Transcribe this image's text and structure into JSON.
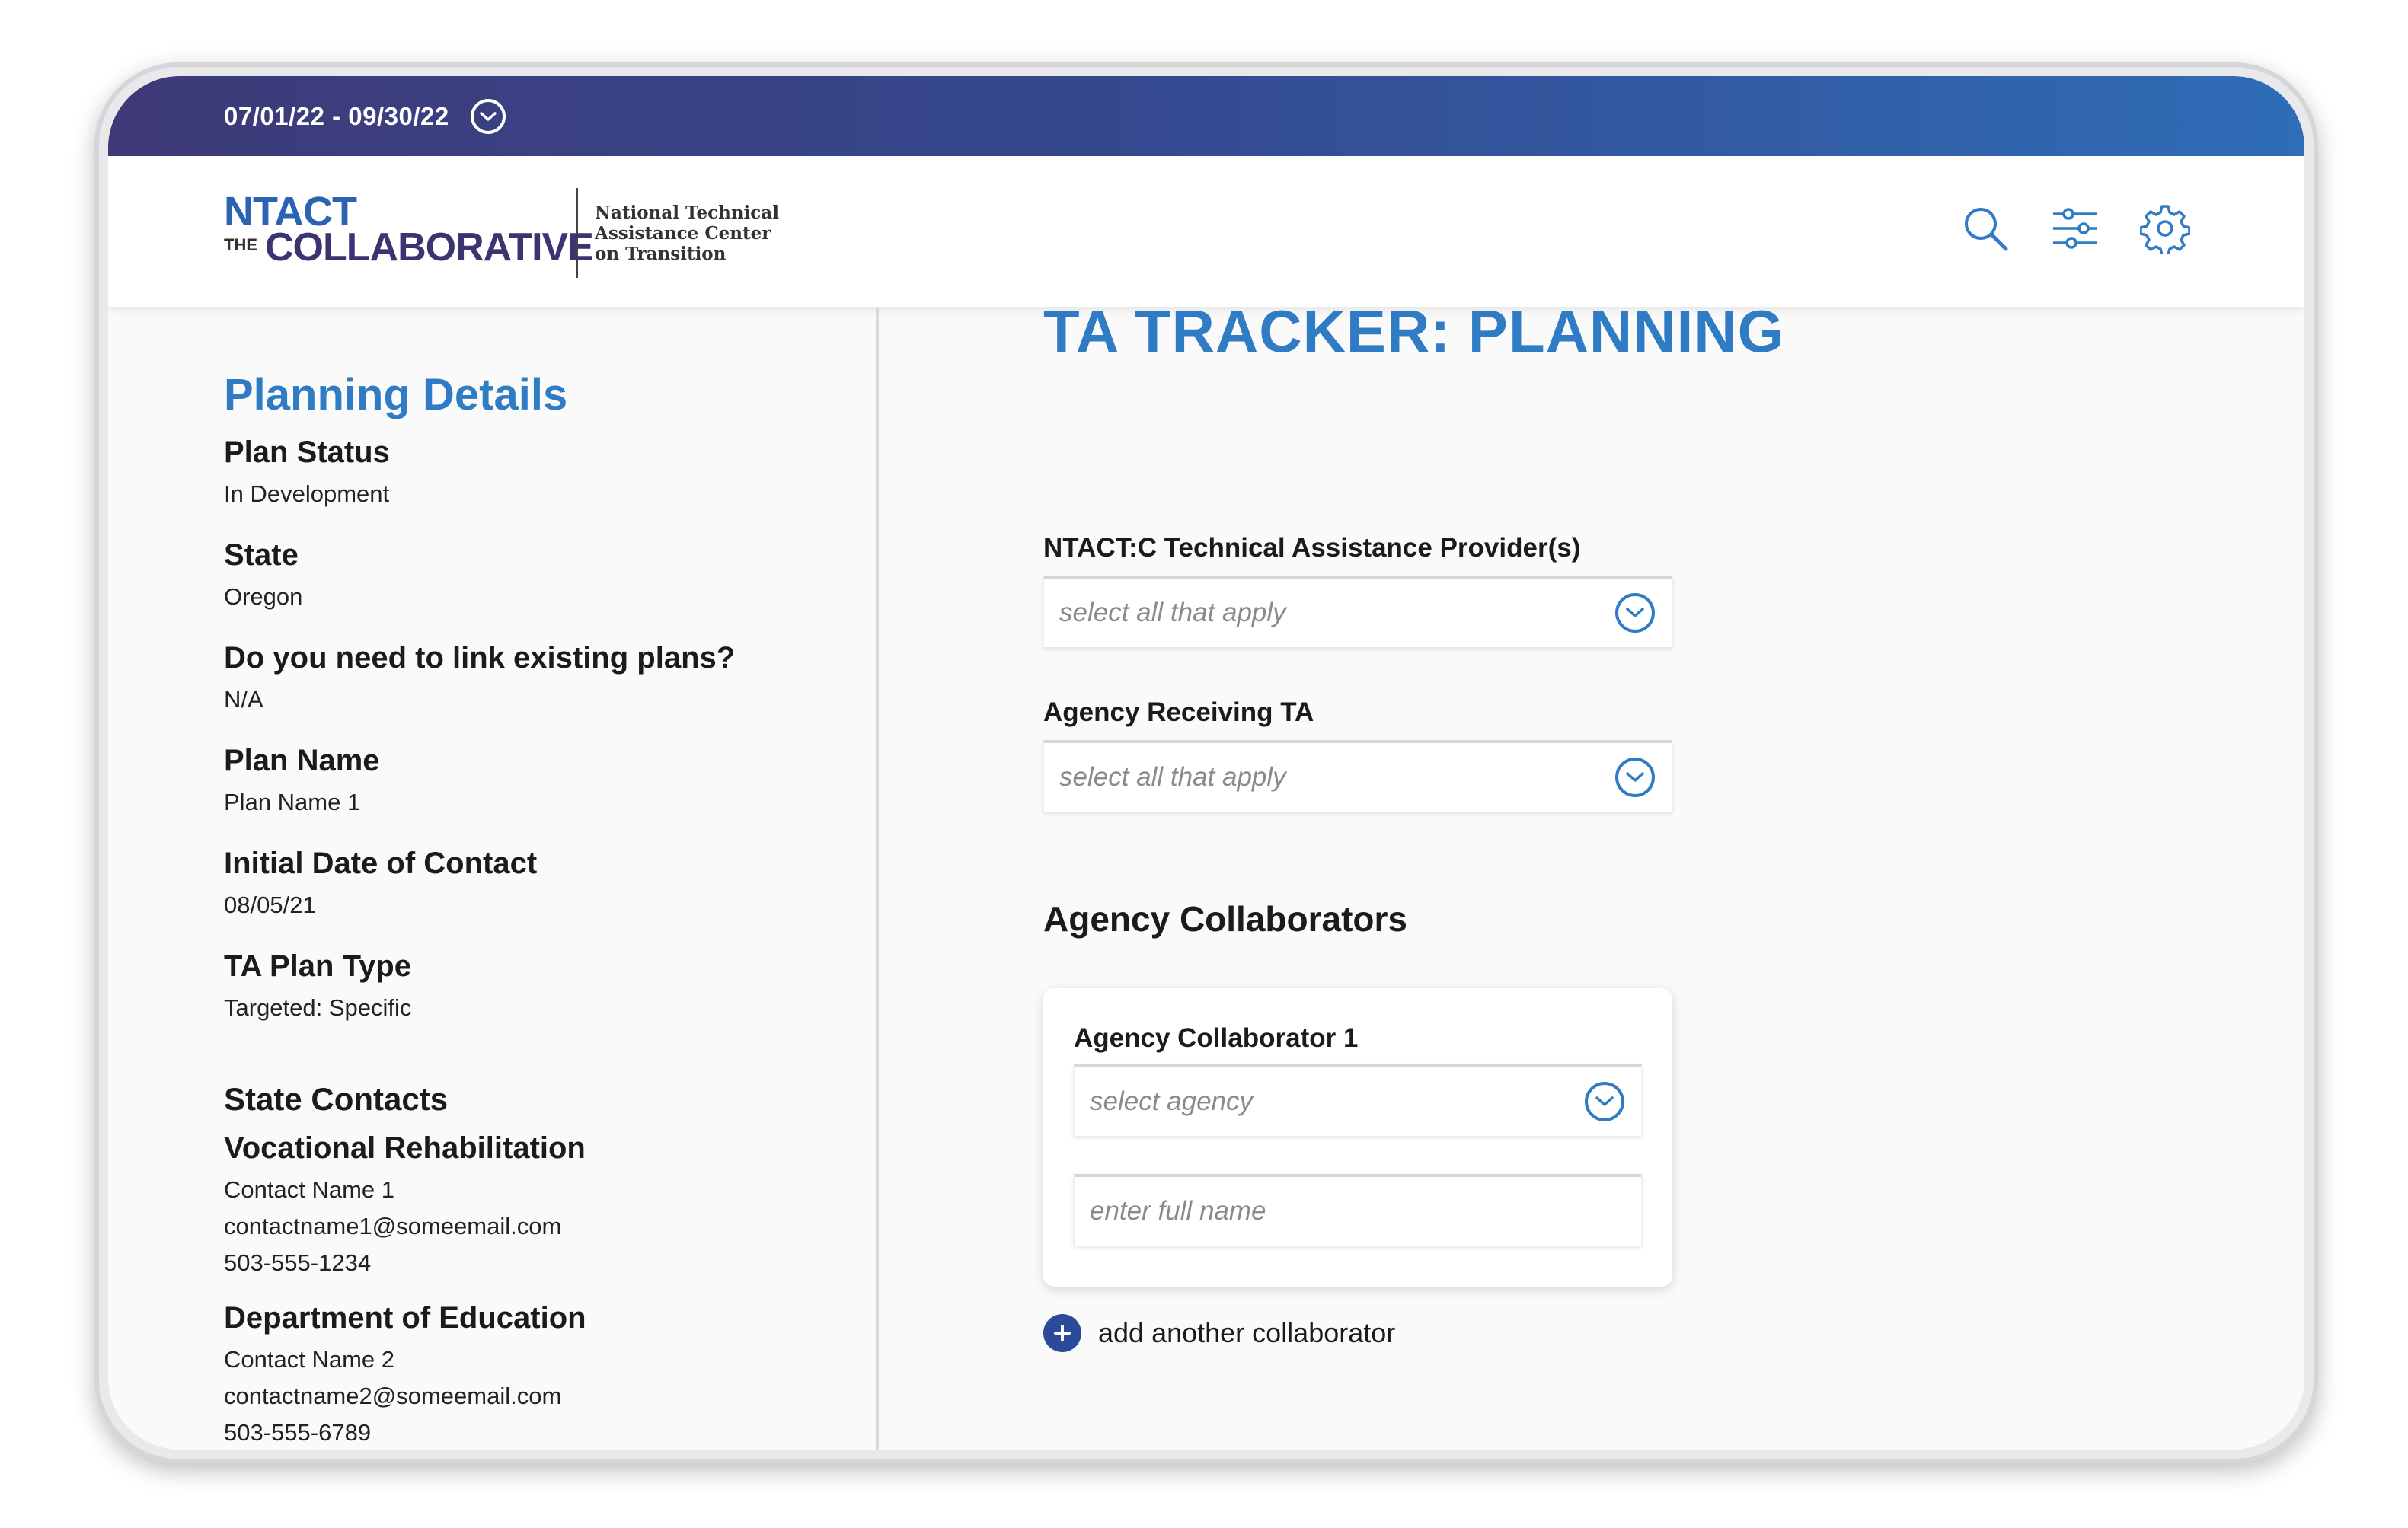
{
  "top_bar": {
    "date_range": "07/01/22 - 09/30/22"
  },
  "header": {
    "logo": {
      "ntact": "NTACT",
      "the": "THE",
      "collaborative": "COLLABORATIVE",
      "subtitle_lines": [
        "National Technical",
        "Assistance Center",
        "on Transition"
      ]
    },
    "icons": [
      "search-icon",
      "filter-sliders-icon",
      "gear-icon"
    ]
  },
  "left_panel": {
    "title": "Planning Details",
    "fields": [
      {
        "label": "Plan Status",
        "value": "In Development"
      },
      {
        "label": "State",
        "value": "Oregon"
      },
      {
        "label": "Do you need to link existing plans?",
        "value": "N/A"
      },
      {
        "label": "Plan Name",
        "value": "Plan Name 1"
      },
      {
        "label": "Initial Date of Contact",
        "value": "08/05/21"
      },
      {
        "label": "TA Plan Type",
        "value": "Targeted: Specific"
      }
    ],
    "state_contacts": {
      "title": "State Contacts",
      "contacts": [
        {
          "agency": "Vocational Rehabilitation",
          "name": "Contact Name 1",
          "email": "contactname1@someemail.com",
          "phone": "503-555-1234"
        },
        {
          "agency": "Department of Education",
          "name": "Contact Name 2",
          "email": "contactname2@someemail.com",
          "phone": "503-555-6789"
        }
      ]
    }
  },
  "main": {
    "page_title": "TA TRACKER: PLANNING",
    "providers": {
      "label": "NTACT:C Technical Assistance Provider(s)",
      "placeholder": "select all that apply"
    },
    "agency_receiving": {
      "label": "Agency Receiving TA",
      "placeholder": "select all that apply"
    },
    "collaborators": {
      "title": "Agency Collaborators",
      "card": {
        "label": "Agency Collaborator 1",
        "agency_placeholder": "select agency",
        "name_placeholder": "enter full name"
      },
      "add_label": "add another collaborator"
    }
  },
  "colors": {
    "accent": "#2f7bc4",
    "gradient_start": "#3e3a78",
    "gradient_end": "#2f6db7",
    "add_button": "#2c4a9a"
  }
}
